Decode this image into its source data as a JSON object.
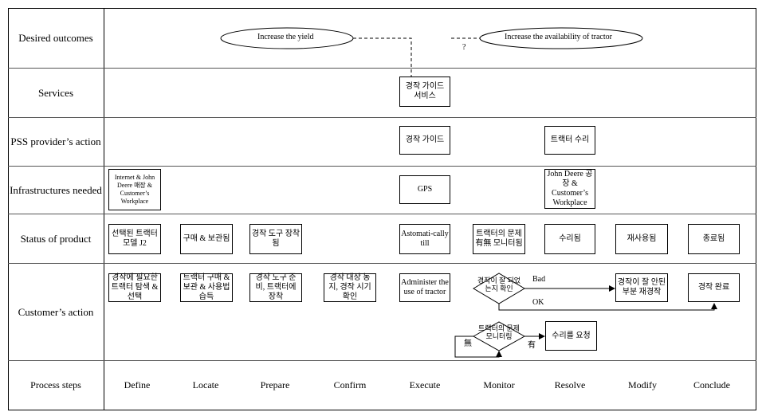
{
  "rows": [
    "Desired outcomes",
    "Services",
    "PSS provider’s action",
    "Infrastructures needed",
    "Status of product",
    "Customer’s action",
    "Process steps"
  ],
  "outcomes": {
    "yield": "Increase the yield",
    "availability": "Increase the availability of tractor",
    "question": "?"
  },
  "services": {
    "guide": "경작 가이드 서비스"
  },
  "pss": {
    "guide": "경작 가이드",
    "repair": "트랙터 수리"
  },
  "infra": {
    "define": "Internet & John Deere 매장 & Customer’s Workplace",
    "gps": "GPS",
    "resolve": "John Deere 공장 & Customer’s Workplace"
  },
  "status": [
    "선택된 트랙터 모델 J2",
    "구매 & 보관됨",
    "경작 도구 장착됨",
    "Astomati-cally till",
    "트랙터의 문제 有無 모니터됨",
    "수리됨",
    "재사용됨",
    "종료됨"
  ],
  "customer": {
    "define": "경작에 필요한 트랙터 탐색 & 선택",
    "locate": "트랙터 구매 & 보관 & 사용법 습득",
    "prepare": "경작 도구 준비, 트랙터에 장착",
    "confirm": "경작 대상 농지, 경작 시기 확인",
    "execute": "Administer the use of tractor",
    "decision1": "경작이 잘 되었는지 확인",
    "bad": "Bad",
    "ok": "OK",
    "modify": "경작이 잘 안된 부분 재경작",
    "conclude": "경작 완료",
    "decision2": "트랙터의 문제 모니터링",
    "no": "無",
    "yes": "有",
    "repair": "수리를 요청"
  },
  "steps": [
    "Define",
    "Locate",
    "Prepare",
    "Confirm",
    "Execute",
    "Monitor",
    "Resolve",
    "Modify",
    "Conclude"
  ]
}
